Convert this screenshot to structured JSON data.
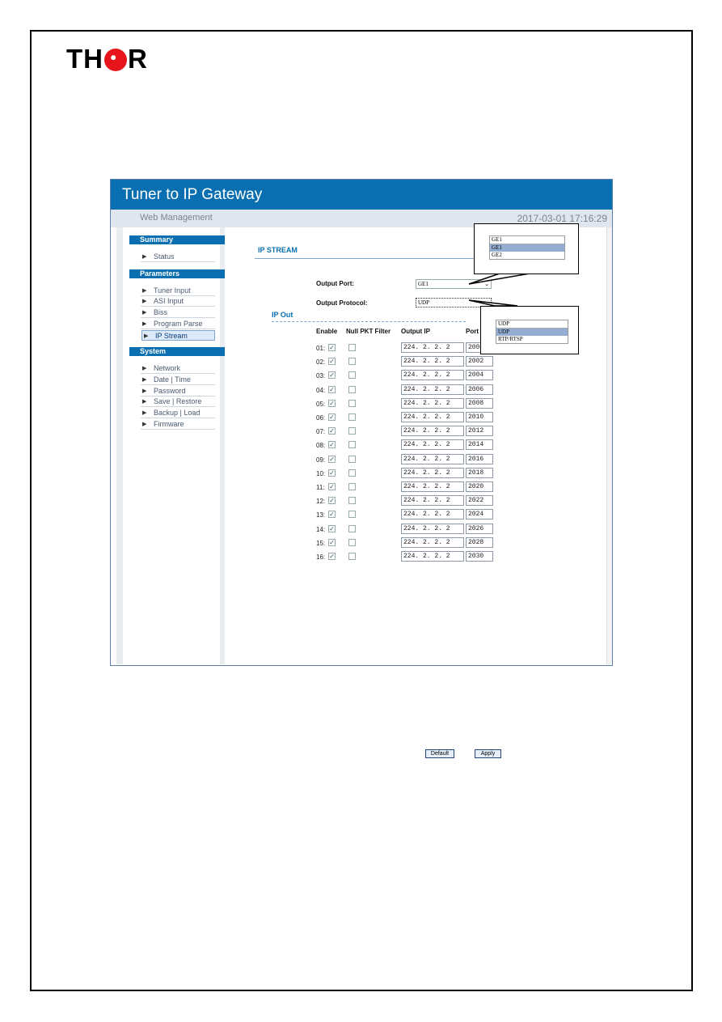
{
  "logo": {
    "text": "THOR"
  },
  "app": {
    "title": "Tuner to IP Gateway",
    "subtitle": "Web Management",
    "datetime": "2017-03-01 17:16:29"
  },
  "sidebar": {
    "sections": [
      {
        "title": "Summary",
        "items": [
          {
            "label": "Status"
          }
        ]
      },
      {
        "title": "Parameters",
        "items": [
          {
            "label": "Tuner Input"
          },
          {
            "label": "ASI Input"
          },
          {
            "label": "Biss"
          },
          {
            "label": "Program Parse"
          },
          {
            "label": "IP Stream",
            "active": true
          }
        ]
      },
      {
        "title": "System",
        "items": [
          {
            "label": "Network"
          },
          {
            "label": "Date | Time"
          },
          {
            "label": "Password"
          },
          {
            "label": "Save | Restore"
          },
          {
            "label": "Backup | Load"
          },
          {
            "label": "Firmware"
          }
        ]
      }
    ]
  },
  "main": {
    "title": "IP STREAM",
    "output_port_label": "Output Port:",
    "output_port_value": "GE1",
    "output_protocol_label": "Output Protocol:",
    "output_protocol_value": "UDP",
    "ip_out_title": "IP Out",
    "columns": [
      "Enable",
      "Null PKT Filter",
      "Output IP",
      "Port"
    ],
    "rows": [
      {
        "n": "01:",
        "enable": true,
        "null": false,
        "ip": "224. 2. 2. 2",
        "port": "2000"
      },
      {
        "n": "02:",
        "enable": true,
        "null": false,
        "ip": "224. 2. 2. 2",
        "port": "2002"
      },
      {
        "n": "03:",
        "enable": true,
        "null": false,
        "ip": "224. 2. 2. 2",
        "port": "2004"
      },
      {
        "n": "04:",
        "enable": true,
        "null": false,
        "ip": "224. 2. 2. 2",
        "port": "2006"
      },
      {
        "n": "05:",
        "enable": true,
        "null": false,
        "ip": "224. 2. 2. 2",
        "port": "2008"
      },
      {
        "n": "06:",
        "enable": true,
        "null": false,
        "ip": "224. 2. 2. 2",
        "port": "2010"
      },
      {
        "n": "07:",
        "enable": true,
        "null": false,
        "ip": "224. 2. 2. 2",
        "port": "2012"
      },
      {
        "n": "08:",
        "enable": true,
        "null": false,
        "ip": "224. 2. 2. 2",
        "port": "2014"
      },
      {
        "n": "09:",
        "enable": true,
        "null": false,
        "ip": "224. 2. 2. 2",
        "port": "2016"
      },
      {
        "n": "10:",
        "enable": true,
        "null": false,
        "ip": "224. 2. 2. 2",
        "port": "2018"
      },
      {
        "n": "11:",
        "enable": true,
        "null": false,
        "ip": "224. 2. 2. 2",
        "port": "2020"
      },
      {
        "n": "12:",
        "enable": true,
        "null": false,
        "ip": "224. 2. 2. 2",
        "port": "2022"
      },
      {
        "n": "13:",
        "enable": true,
        "null": false,
        "ip": "224. 2. 2. 2",
        "port": "2024"
      },
      {
        "n": "14:",
        "enable": true,
        "null": false,
        "ip": "224. 2. 2. 2",
        "port": "2026"
      },
      {
        "n": "15:",
        "enable": true,
        "null": false,
        "ip": "224. 2. 2. 2",
        "port": "2028"
      },
      {
        "n": "16:",
        "enable": true,
        "null": false,
        "ip": "224. 2. 2. 2",
        "port": "2030"
      }
    ],
    "default_label": "Default",
    "apply_label": "Apply"
  },
  "callouts": {
    "port": {
      "selected": "GE1",
      "options": [
        "GE1",
        "GE2"
      ],
      "highlighted": "GE1"
    },
    "protocol": {
      "selected": "UDP",
      "options": [
        "UDP",
        "RTP/RTSP"
      ],
      "highlighted": "UDP"
    }
  },
  "colors": {
    "header": "#0a6fb0",
    "accent": "#0a6fb0",
    "logo_red": "#e8141c"
  }
}
